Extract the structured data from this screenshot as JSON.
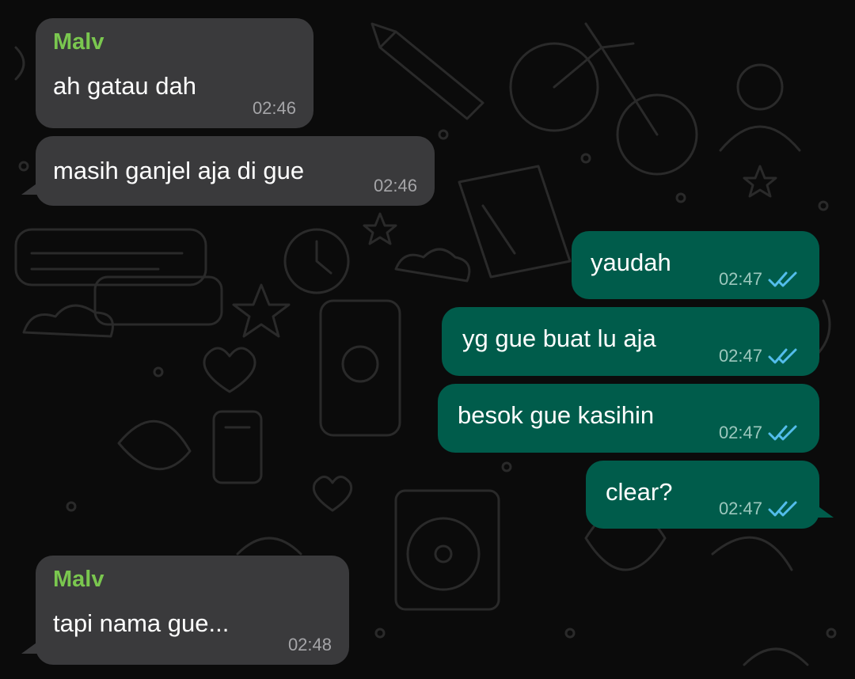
{
  "colors": {
    "incoming_bubble": "#3a3a3c",
    "outgoing_bubble": "#005c4b",
    "sender_name": "#7ac74f",
    "read_ticks": "#53bdeb",
    "wallpaper": "#0b0b0b"
  },
  "messages": [
    {
      "direction": "incoming",
      "sender": "Malv",
      "text": "ah gatau dah",
      "time": "02:46"
    },
    {
      "direction": "incoming",
      "text": "masih ganjel aja di gue",
      "time": "02:46"
    },
    {
      "direction": "outgoing",
      "text": "yaudah",
      "time": "02:47",
      "status": "read"
    },
    {
      "direction": "outgoing",
      "text": "yg gue buat lu aja",
      "time": "02:47",
      "status": "read"
    },
    {
      "direction": "outgoing",
      "text": "besok gue kasihin",
      "time": "02:47",
      "status": "read"
    },
    {
      "direction": "outgoing",
      "text": "clear?",
      "time": "02:47",
      "status": "read"
    },
    {
      "direction": "incoming",
      "sender": "Malv",
      "text": "tapi nama gue...",
      "time": "02:48"
    }
  ],
  "icons": {
    "read_receipt": "double-check-icon"
  }
}
